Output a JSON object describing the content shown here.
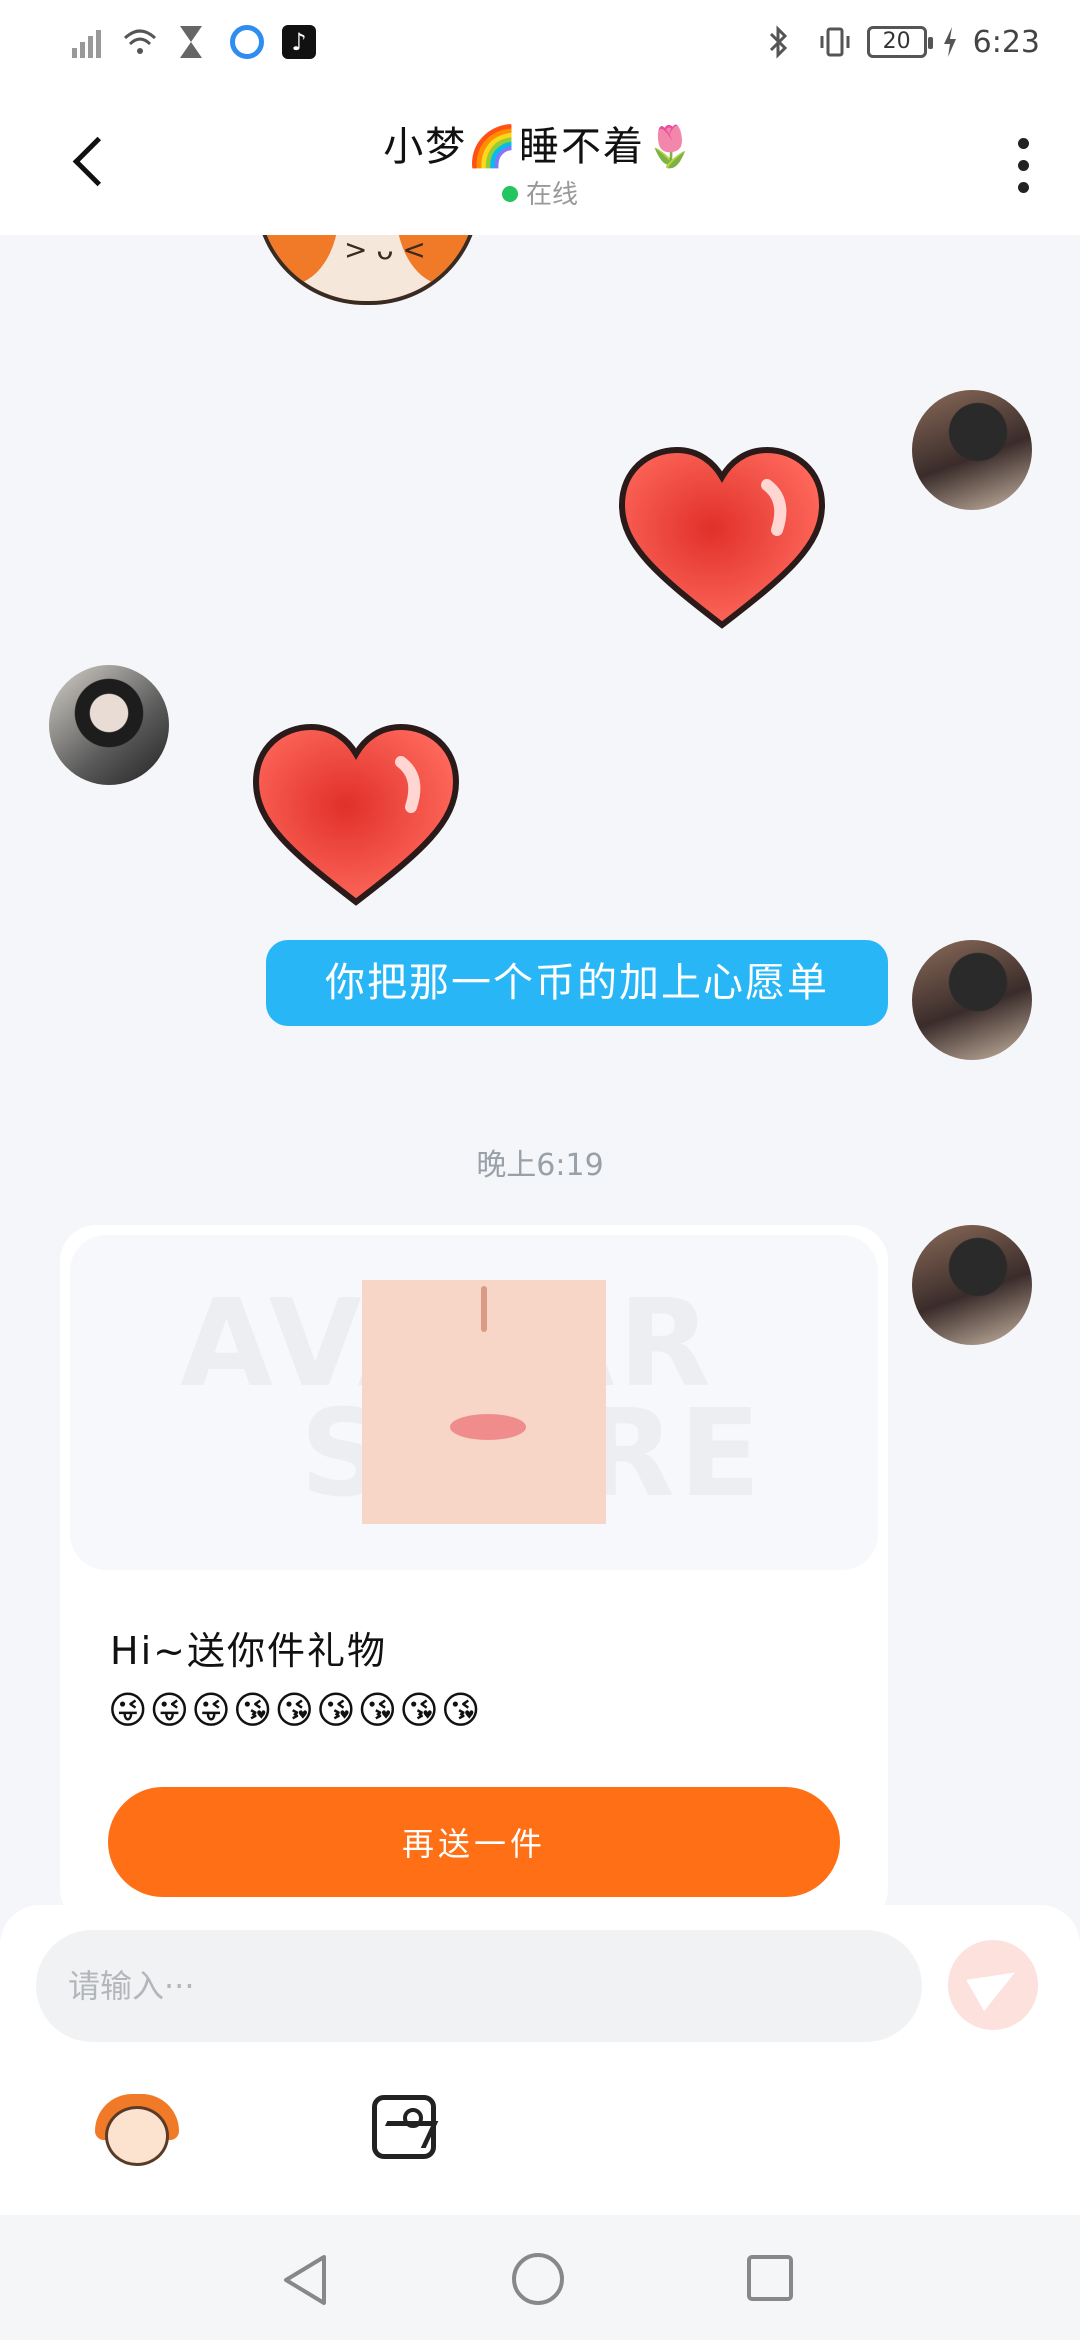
{
  "status_bar": {
    "time": "6:23",
    "battery": "20",
    "app_icon_tiktok": "♪"
  },
  "header": {
    "title": "小梦🌈睡不着🌷",
    "status": "在线"
  },
  "chat": {
    "sticker_face": "> ᴗ <",
    "outgoing_text": "你把那一个币的加上心愿单",
    "timestamp": "晚上6:19",
    "gift_card": {
      "watermark_line1": "AVATAR",
      "watermark_line2": "STORE",
      "title": "Hi~送你件礼物",
      "emojis": "😜😜😜😘😘😘😘😘😘",
      "button_label": "再送一件"
    }
  },
  "composer": {
    "placeholder": "请输入···"
  },
  "colors": {
    "accent_orange": "#ff6f15",
    "bubble_blue": "#29b6f6",
    "online_green": "#22c55e"
  }
}
